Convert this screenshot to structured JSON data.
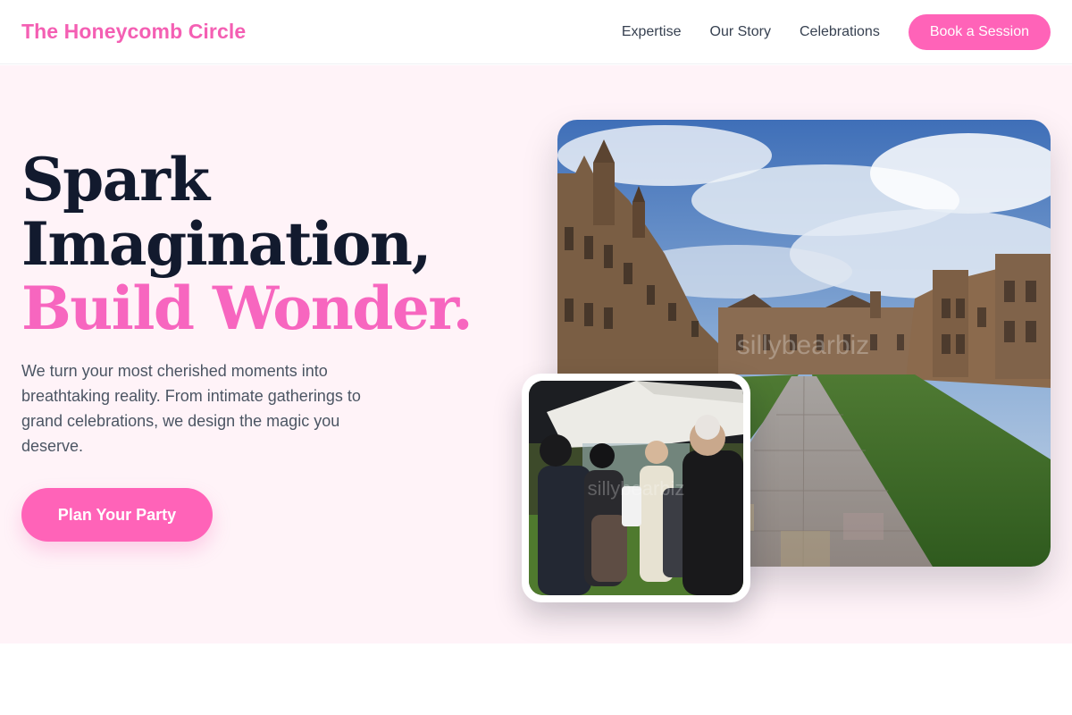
{
  "header": {
    "brand": "The Honeycomb Circle",
    "nav": [
      "Expertise",
      "Our Story",
      "Celebrations"
    ],
    "cta_label": "Book a Session"
  },
  "hero": {
    "headline_line1": "Spark",
    "headline_line2": "Imagination,",
    "headline_line3": "Build Wonder.",
    "lede": "We turn your most cherished moments into breathtaking reality. From intimate gatherings to grand celebrations, we design the magic you deserve.",
    "cta_label": "Plan Your Party",
    "main_image": "university-quadrangle-photo",
    "inset_image": "garden-party-crowd-photo",
    "watermark": "sillybearbiz"
  },
  "colors": {
    "brand_pink": "#f45fb3",
    "button_pink": "#ff63b8",
    "hero_background": "#fff3f8",
    "headline_dark": "#121a2e",
    "body_text": "#4b5563"
  }
}
